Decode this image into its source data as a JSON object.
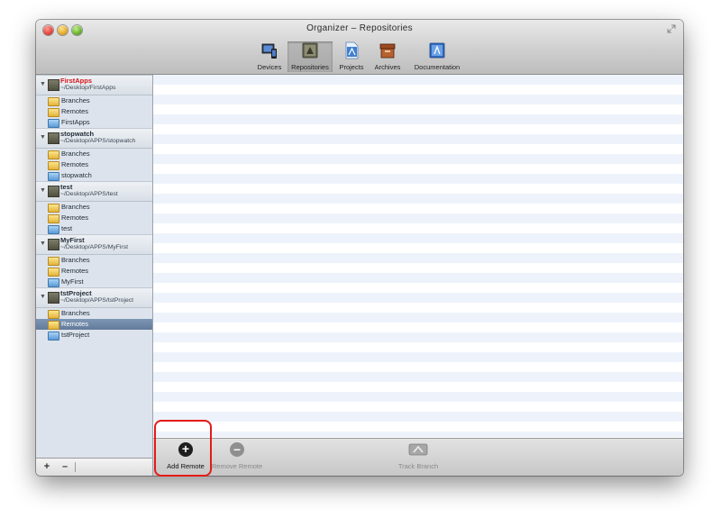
{
  "window": {
    "title": "Organizer – Repositories"
  },
  "toolbar": {
    "items": [
      {
        "label": "Devices",
        "icon": "devices-icon"
      },
      {
        "label": "Repositories",
        "icon": "repositories-icon",
        "selected": true
      },
      {
        "label": "Projects",
        "icon": "projects-icon"
      },
      {
        "label": "Archives",
        "icon": "archives-icon"
      },
      {
        "label": "Documentation",
        "icon": "documentation-icon"
      }
    ]
  },
  "sidebar": {
    "repos": [
      {
        "name": "FirstApps",
        "path": "~/Desktop/FirstApps",
        "name_color": "#d8141b",
        "items": [
          "Branches",
          "Remotes",
          "FirstApps"
        ]
      },
      {
        "name": "stopwatch",
        "path": "~/Desktop/APPS/stopwatch",
        "items": [
          "Branches",
          "Remotes",
          "stopwatch"
        ]
      },
      {
        "name": "test",
        "path": "~/Desktop/APPS/test",
        "items": [
          "Branches",
          "Remotes",
          "test"
        ]
      },
      {
        "name": "MyFirst",
        "path": "~/Desktop/APPS/MyFirst",
        "items": [
          "Branches",
          "Remotes",
          "MyFirst"
        ]
      },
      {
        "name": "tstProject",
        "path": "~/Desktop/APPS/tstProject",
        "items": [
          "Branches",
          "Remotes",
          "tstProject"
        ],
        "selected_item": "Remotes"
      }
    ],
    "bottom": {
      "add_label": "+",
      "remove_label": "–"
    }
  },
  "bottombar": {
    "add_remote": "Add Remote",
    "remove_remote": "Remove Remote",
    "track_branch": "Track Branch"
  },
  "colors": {
    "highlight_box": "#e41b17",
    "selection": "#6f88a8",
    "sidebar_bg": "#dce3ec"
  }
}
